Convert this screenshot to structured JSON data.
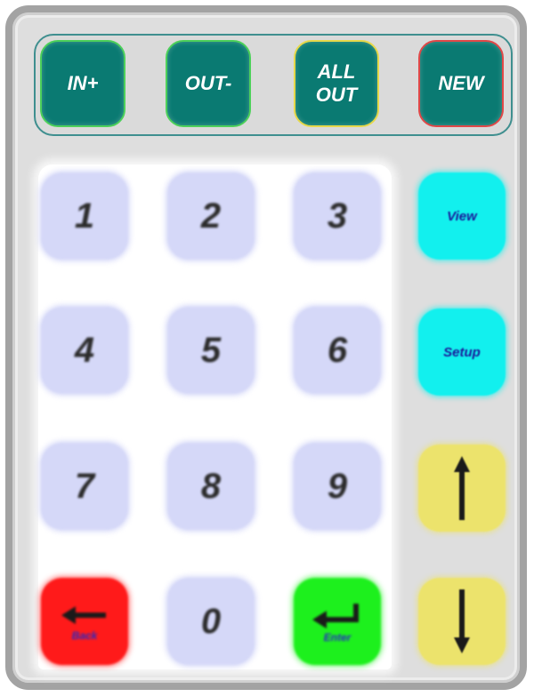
{
  "top_buttons": {
    "in": "IN+",
    "out": "OUT-",
    "all_out": "ALL\nOUT",
    "new": "NEW"
  },
  "keypad": {
    "digits": [
      "1",
      "2",
      "3",
      "4",
      "5",
      "6",
      "7",
      "8",
      "9",
      "0"
    ],
    "backspace_label": "Back",
    "enter_label": "Enter"
  },
  "side_buttons": {
    "view": "View",
    "setup": "Setup"
  },
  "icons": {
    "backspace": "left-arrow-icon",
    "enter": "enter-arrow-icon",
    "up": "up-arrow-icon",
    "down": "down-arrow-icon"
  },
  "colors": {
    "top_button": "#0a7a72",
    "digit_key": "#d5d8f8",
    "side_cyan": "#12f0ee",
    "side_yellow": "#ece36c",
    "backspace": "#ff1a1a",
    "enter": "#1df01d",
    "frame": "#a3a3a3"
  }
}
